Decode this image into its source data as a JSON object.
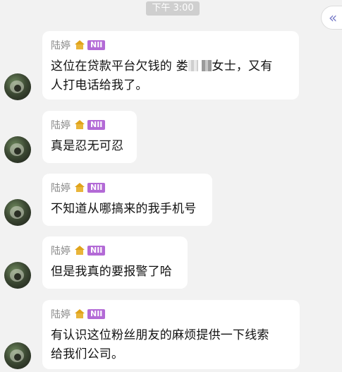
{
  "timestamp": "下午 3:00",
  "collapse_icon": "double-chevron-left-icon",
  "sender": {
    "name": "陆婷",
    "badge": "NII",
    "icon": "home-icon"
  },
  "messages": [
    {
      "line1": "这位在贷款平台欠钱的 娄",
      "line1_end": "女士，又有",
      "line2": "人打电话给我了。"
    },
    {
      "text": "真是忍无可忍"
    },
    {
      "text": "不知道从哪搞来的我手机号"
    },
    {
      "text": "但是我真的要报警了哈"
    },
    {
      "line1": "有认识这位粉丝朋友的麻烦提供一下线索",
      "line2": "给我们公司。"
    }
  ],
  "colors": {
    "background": "#f2f2f2",
    "bubble": "#ffffff",
    "badge": "#b36ad6",
    "name": "#8a8a8a",
    "collapse_icon": "#7a7ec9"
  }
}
